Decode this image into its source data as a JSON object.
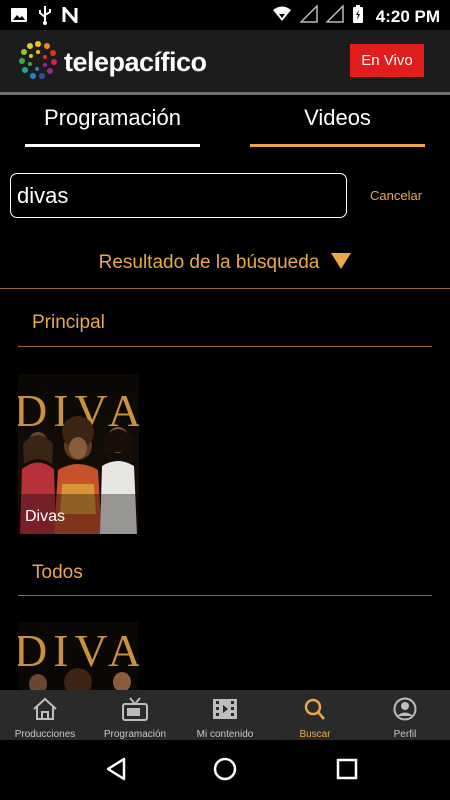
{
  "status_bar": {
    "time": "4:20 PM",
    "icons_left": [
      "image-icon",
      "usb-icon",
      "n-icon"
    ],
    "icons_right": [
      "wifi-icon",
      "signal-icon",
      "signal-icon",
      "battery-charging-icon"
    ]
  },
  "header": {
    "brand": "telepacífico",
    "live_button": "En Vivo"
  },
  "tabs": [
    {
      "label": "Programación",
      "active": false
    },
    {
      "label": "Videos",
      "active": true
    }
  ],
  "search": {
    "value": "divas",
    "cancel_label": "Cancelar"
  },
  "results": {
    "label": "Resultado de la búsqueda"
  },
  "sections": [
    {
      "title": "Principal",
      "items": [
        {
          "caption": "Divas"
        }
      ]
    },
    {
      "title": "Todos",
      "items": [
        {
          "caption": ""
        }
      ]
    }
  ],
  "bottom_nav": [
    {
      "label": "Producciones",
      "icon": "home-icon",
      "active": false
    },
    {
      "label": "Programación",
      "icon": "tv-icon",
      "active": false
    },
    {
      "label": "Mi contenido",
      "icon": "film-icon",
      "active": false
    },
    {
      "label": "Buscar",
      "icon": "search-icon",
      "active": true
    },
    {
      "label": "Perfil",
      "icon": "profile-icon",
      "active": false
    }
  ],
  "colors": {
    "accent": "#e9a94a",
    "live": "#e11e1e",
    "header_bg": "#1c1c1c",
    "nav_bg": "#2a2a2a"
  }
}
